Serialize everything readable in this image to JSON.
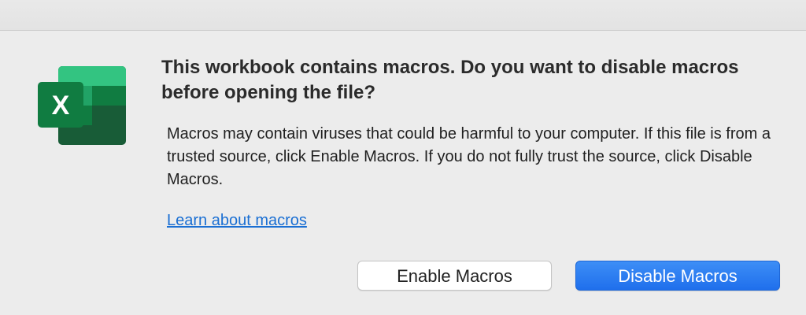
{
  "dialog": {
    "heading": "This workbook contains macros. Do you want to disable macros before opening the file?",
    "body": "Macros may contain viruses that could be harmful to your computer.  If this file is from a trusted source, click Enable Macros. If you do not fully trust the source, click Disable Macros.",
    "learn_link": "Learn about macros",
    "enable_button": "Enable Macros",
    "disable_button": "Disable Macros",
    "app_icon": {
      "name": "excel-icon",
      "letter": "X"
    }
  },
  "colors": {
    "accent": "#1f6fec",
    "link": "#1a6fd3",
    "excel_dark": "#185c37",
    "excel_mid": "#21a366",
    "excel_light": "#33c481"
  }
}
